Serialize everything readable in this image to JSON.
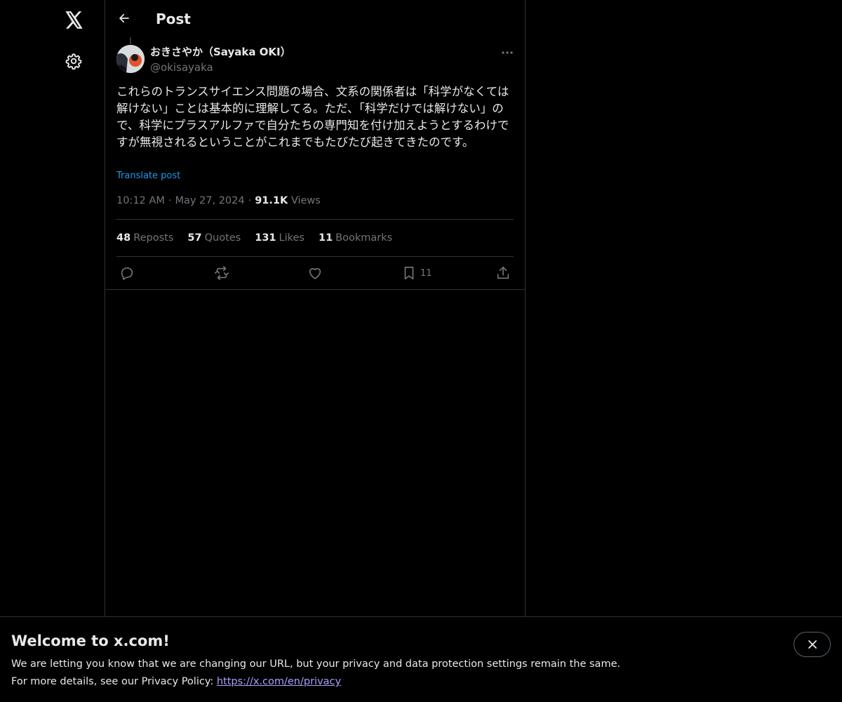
{
  "app": {
    "logo_icon": "x-logo-icon",
    "settings_icon": "gear-icon"
  },
  "header": {
    "title": "Post",
    "back_icon": "arrow-left-icon"
  },
  "post": {
    "author_name": "おきさやか（Sayaka OKI）",
    "author_handle": "@okisayaka",
    "text": "これらのトランスサイエンス問題の場合、文系の関係者は「科学がなくては解けない」ことは基本的に理解してる。ただ、「科学だけでは解けない」ので、科学にプラスアルファで自分たちの専門知を付け加えようとするわけですが無視されるということがこれまでもたびたび起きてきたのです。",
    "translate_label": "Translate post",
    "time": "10:12 AM",
    "date": "May 27, 2024",
    "views_count": "91.1K",
    "views_label": "Views",
    "separator": "·"
  },
  "stats": [
    {
      "count": "48",
      "label": "Reposts"
    },
    {
      "count": "57",
      "label": "Quotes"
    },
    {
      "count": "131",
      "label": "Likes"
    },
    {
      "count": "11",
      "label": "Bookmarks"
    }
  ],
  "actions": {
    "reply_icon": "reply-icon",
    "repost_icon": "repost-icon",
    "like_icon": "heart-icon",
    "bookmark_icon": "bookmark-icon",
    "bookmark_count": "11",
    "share_icon": "share-icon"
  },
  "banner": {
    "title": "Welcome to x.com!",
    "line1": "We are letting you know that we are changing our URL, but your privacy and data protection settings remain the same.",
    "line2_prefix": "For more details, see our Privacy Policy: ",
    "link_text": "https://x.com/en/privacy",
    "close_icon": "close-icon"
  },
  "colors": {
    "background": "#000000",
    "text_primary": "#e7e9ea",
    "text_secondary": "#71767b",
    "accent": "#1d9bf0",
    "link_visited": "#a6a1ff",
    "border": "#2f3336"
  }
}
